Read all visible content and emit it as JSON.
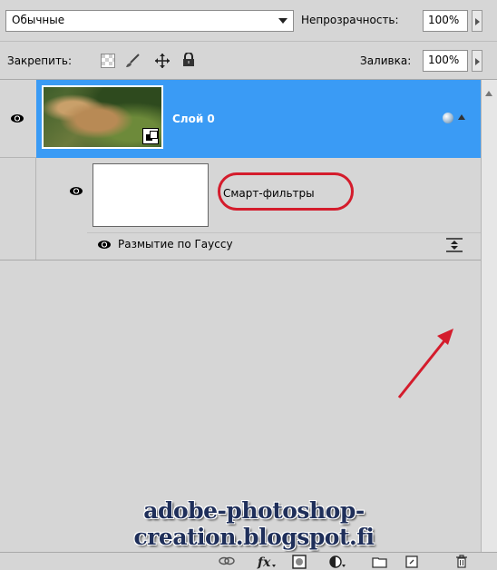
{
  "options": {
    "blend_mode": "Обычные",
    "opacity_label": "Непрозрачность:",
    "opacity_value": "100%",
    "lock_label": "Закрепить:",
    "fill_label": "Заливка:",
    "fill_value": "100%"
  },
  "layers": [
    {
      "name": "Слой 0",
      "selected": true,
      "smart_filters": {
        "label": "Смарт-фильтры",
        "effects": [
          {
            "name": "Размытие по Гауссу"
          }
        ]
      }
    }
  ],
  "watermark": "adobe-photoshop-creation.blogspot.fi",
  "colors": {
    "selection": "#3a9bf5",
    "panel": "#d6d6d6",
    "annotation": "#d41c2c"
  },
  "icons": {
    "lock_transparent": "checkerboard-icon",
    "lock_image": "brush-icon",
    "lock_position": "move-icon",
    "lock_all": "padlock-icon",
    "footer": [
      "link-icon",
      "fx-icon",
      "mask-icon",
      "adjustment-icon",
      "folder-icon",
      "new-layer-icon",
      "trash-icon"
    ]
  }
}
